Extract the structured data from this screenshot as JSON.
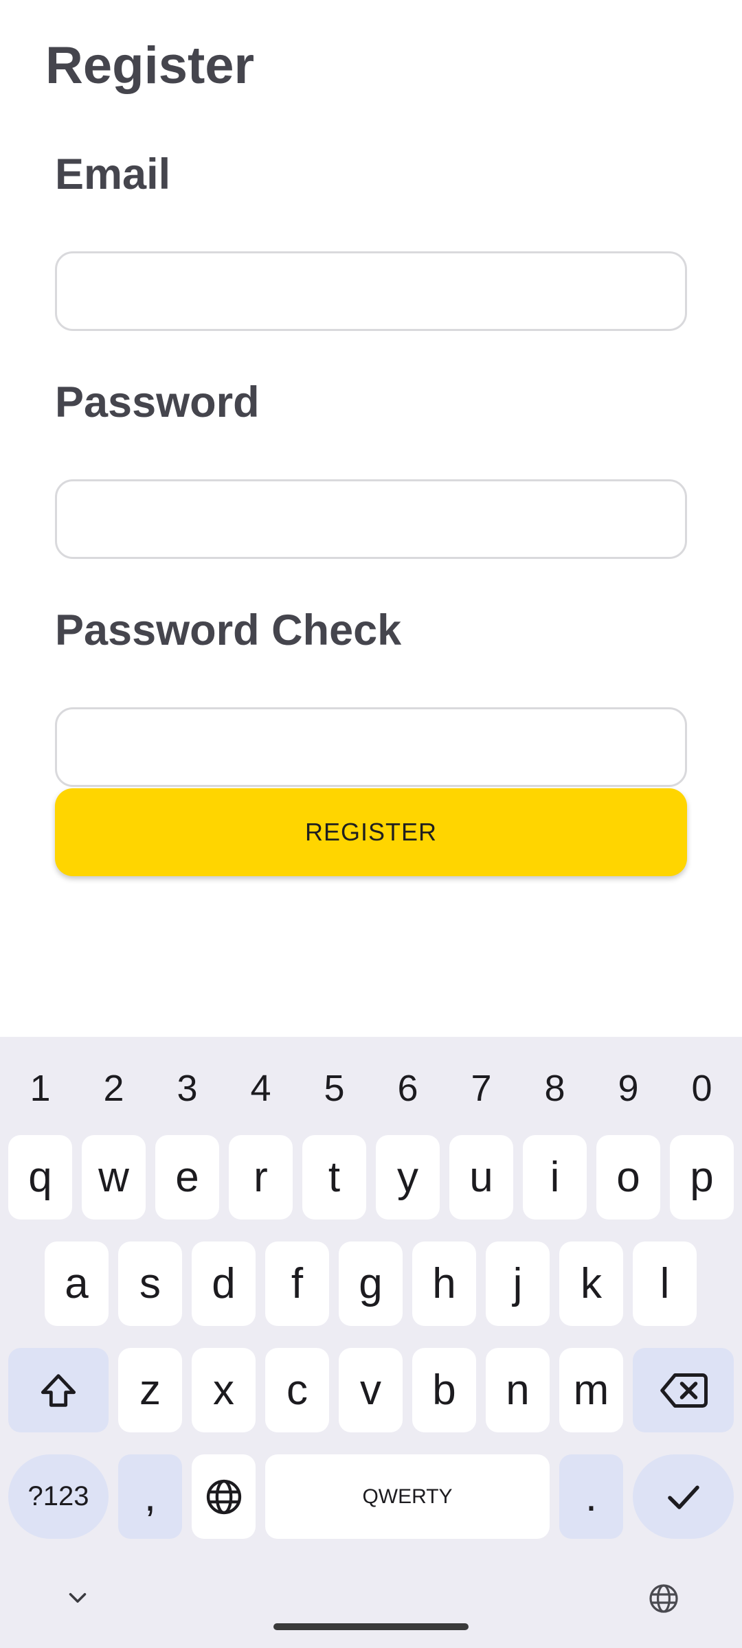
{
  "app": {
    "title": "Register",
    "email_label": "Email",
    "email_value": "",
    "password_label": "Password",
    "password_value": "",
    "password_check_label": "Password Check",
    "password_check_value": "",
    "register_button": "REGISTER",
    "accent_color": "#ffd500"
  },
  "keyboard": {
    "numbers": [
      "1",
      "2",
      "3",
      "4",
      "5",
      "6",
      "7",
      "8",
      "9",
      "0"
    ],
    "row1": [
      "q",
      "w",
      "e",
      "r",
      "t",
      "y",
      "u",
      "i",
      "o",
      "p"
    ],
    "row2": [
      "a",
      "s",
      "d",
      "f",
      "g",
      "h",
      "j",
      "k",
      "l"
    ],
    "row3": [
      "z",
      "x",
      "c",
      "v",
      "b",
      "n",
      "m"
    ],
    "symbols_key": "?123",
    "comma_key": ",",
    "space_label": "QWERTY",
    "period_key": ".",
    "icons": [
      "shift-icon",
      "backspace-icon",
      "globe-icon",
      "checkmark-icon",
      "chevron-down-icon"
    ]
  }
}
